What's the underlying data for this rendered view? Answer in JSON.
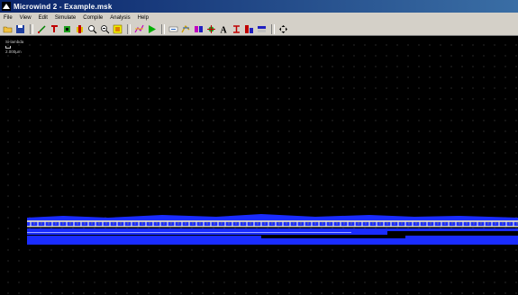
{
  "window": {
    "title": "Microwind 2 - Example.msk"
  },
  "menu": {
    "items": [
      "File",
      "View",
      "Edit",
      "Simulate",
      "Compile",
      "Analysis",
      "Help"
    ]
  },
  "toolbar": {
    "icons": [
      "open-icon",
      "save-icon",
      "box-icon",
      "wire-icon",
      "contact-icon",
      "pmos-icon",
      "zoom-in-icon",
      "zoom-out-icon",
      "fit-icon",
      "extract-icon",
      "run-icon",
      "move-icon",
      "rotate-icon",
      "stretch-icon",
      "copy-icon",
      "text-icon",
      "process-icon",
      "nmos-icon",
      "stack-icon",
      "arrows-icon"
    ]
  },
  "canvas": {
    "label": "Si-lambda",
    "scale_text": "2.000µm",
    "colors": {
      "background": "#000000",
      "grid": "#4a4a4a",
      "layer": "#1a2cff",
      "metal": "#c8c8c8"
    }
  }
}
